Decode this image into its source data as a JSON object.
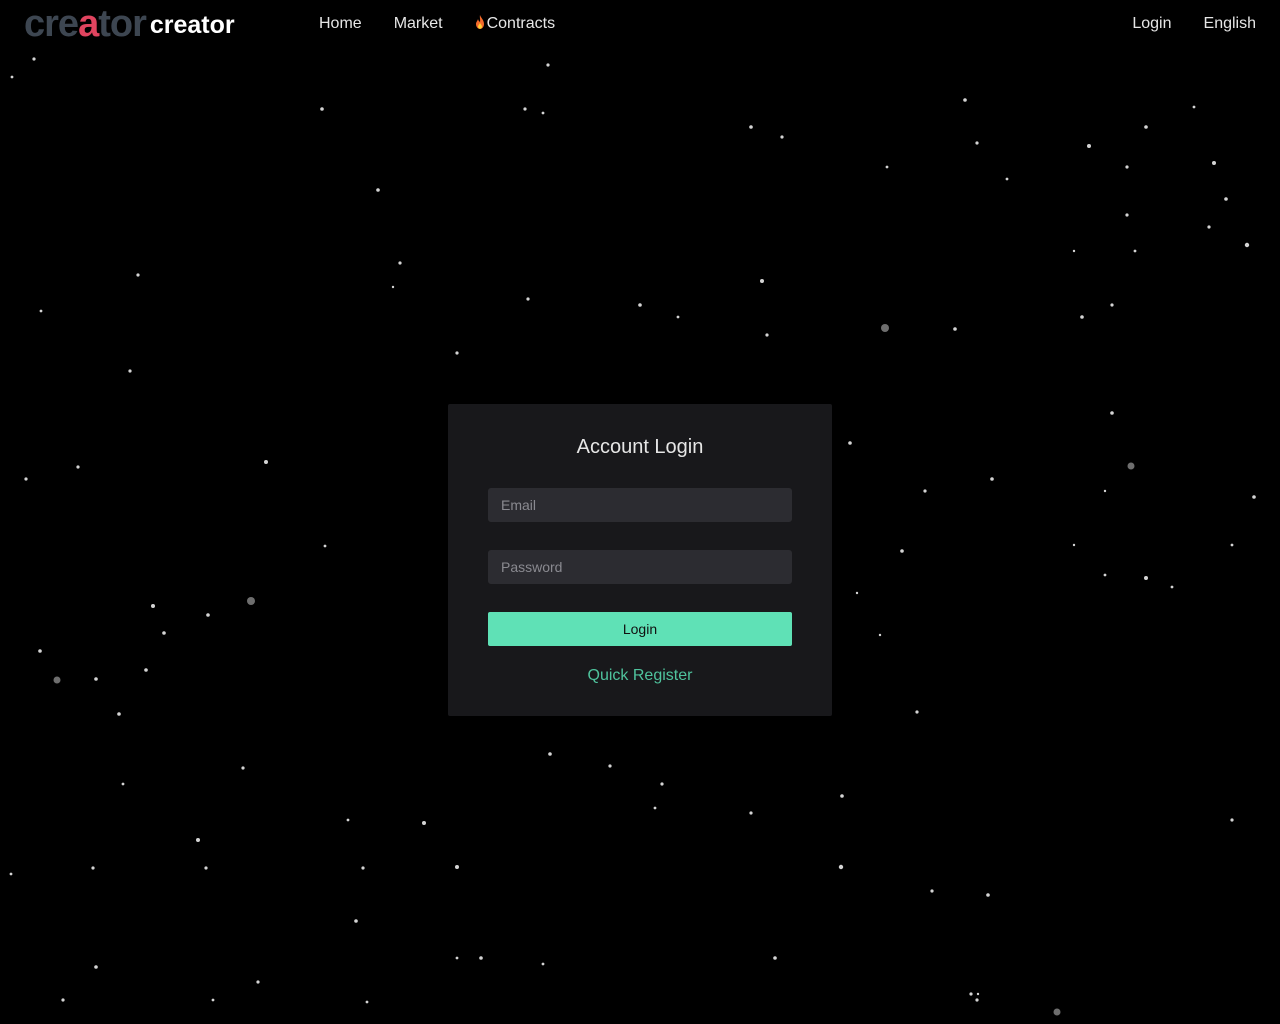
{
  "header": {
    "logo_mark": "creator",
    "logo_text": "creator",
    "nav": [
      {
        "label": "Home"
      },
      {
        "label": "Market"
      },
      {
        "label": "Contracts",
        "icon": "fire-icon"
      }
    ],
    "login_label": "Login",
    "language_label": "English"
  },
  "login_card": {
    "title": "Account Login",
    "email_placeholder": "Email",
    "password_placeholder": "Password",
    "login_button": "Login",
    "register_link": "Quick Register"
  },
  "colors": {
    "background": "#000000",
    "card": "#18181b",
    "input": "#2c2c31",
    "accent": "#5fe1b6",
    "link": "#4fc39d",
    "logo_red": "#e0445f",
    "logo_blue": "#3b6fd8"
  }
}
